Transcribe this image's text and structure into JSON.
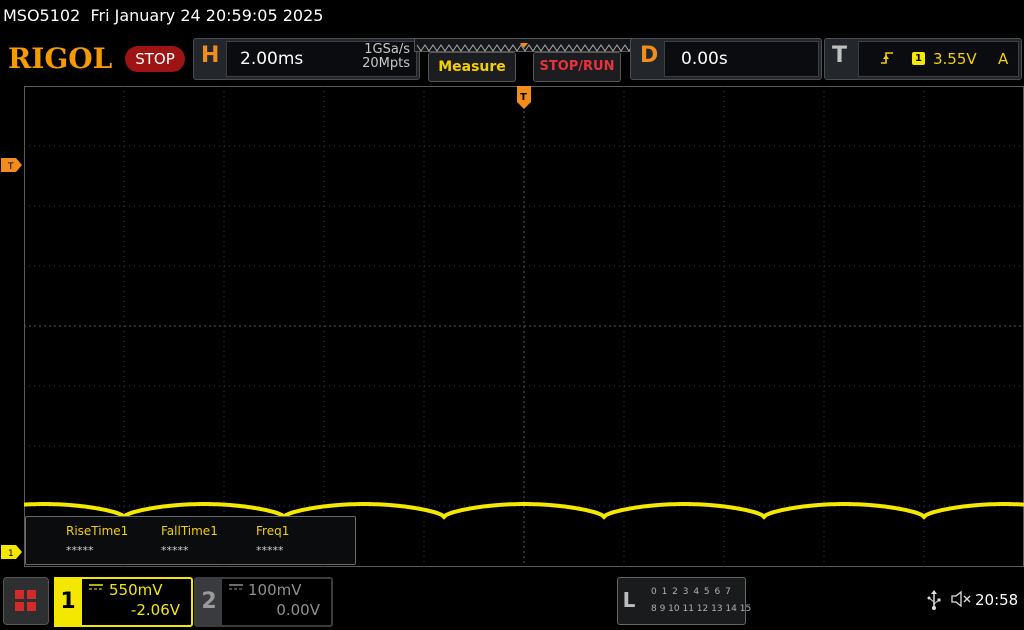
{
  "title_bar": {
    "model": "MSO5102",
    "datetime": "Fri January 24 20:59:05 2025"
  },
  "brand": {
    "logo": "RIGOL",
    "run_state": "STOP"
  },
  "horizontal": {
    "letter": "H",
    "timebase": "2.00ms",
    "sample_rate": "1GSa/s",
    "memory_depth": "20Mpts"
  },
  "buttons": {
    "measure": "Measure",
    "stop_run": "STOP/RUN"
  },
  "delay": {
    "letter": "D",
    "value": "0.00s"
  },
  "trigger": {
    "letter": "T",
    "edge_icon": "rising-edge-icon",
    "source": "1",
    "level": "3.55V",
    "mode": "A"
  },
  "markers": {
    "trigger_level": "T",
    "ch1_ground": "1",
    "trigger_position": "T"
  },
  "measurements": [
    {
      "label": "RiseTime1",
      "value": "*****"
    },
    {
      "label": "FallTime1",
      "value": "*****"
    },
    {
      "label": "Freq1",
      "value": "*****"
    }
  ],
  "channels": [
    {
      "number": "1",
      "coupling_icon": "dc-coupling-icon",
      "scale": "550mV",
      "offset": "-2.06V",
      "active": true,
      "color": "#f5e800"
    },
    {
      "number": "2",
      "coupling_icon": "dc-coupling-icon",
      "scale": "100mV",
      "offset": "0.00V",
      "active": false,
      "color": "#909090"
    }
  ],
  "logic_analyzer": {
    "letter": "L",
    "row1": "0 1 2 3  4 5 6 7",
    "row2": "8 9 10 11 12 13 14 15"
  },
  "status": {
    "usb_icon": "usb-icon",
    "sound_icon": "speaker-muted-icon",
    "time": "20:58"
  },
  "colors": {
    "ch1": "#f5e800",
    "brand_orange": "#f59a00",
    "stop_red": "#9e1414"
  }
}
